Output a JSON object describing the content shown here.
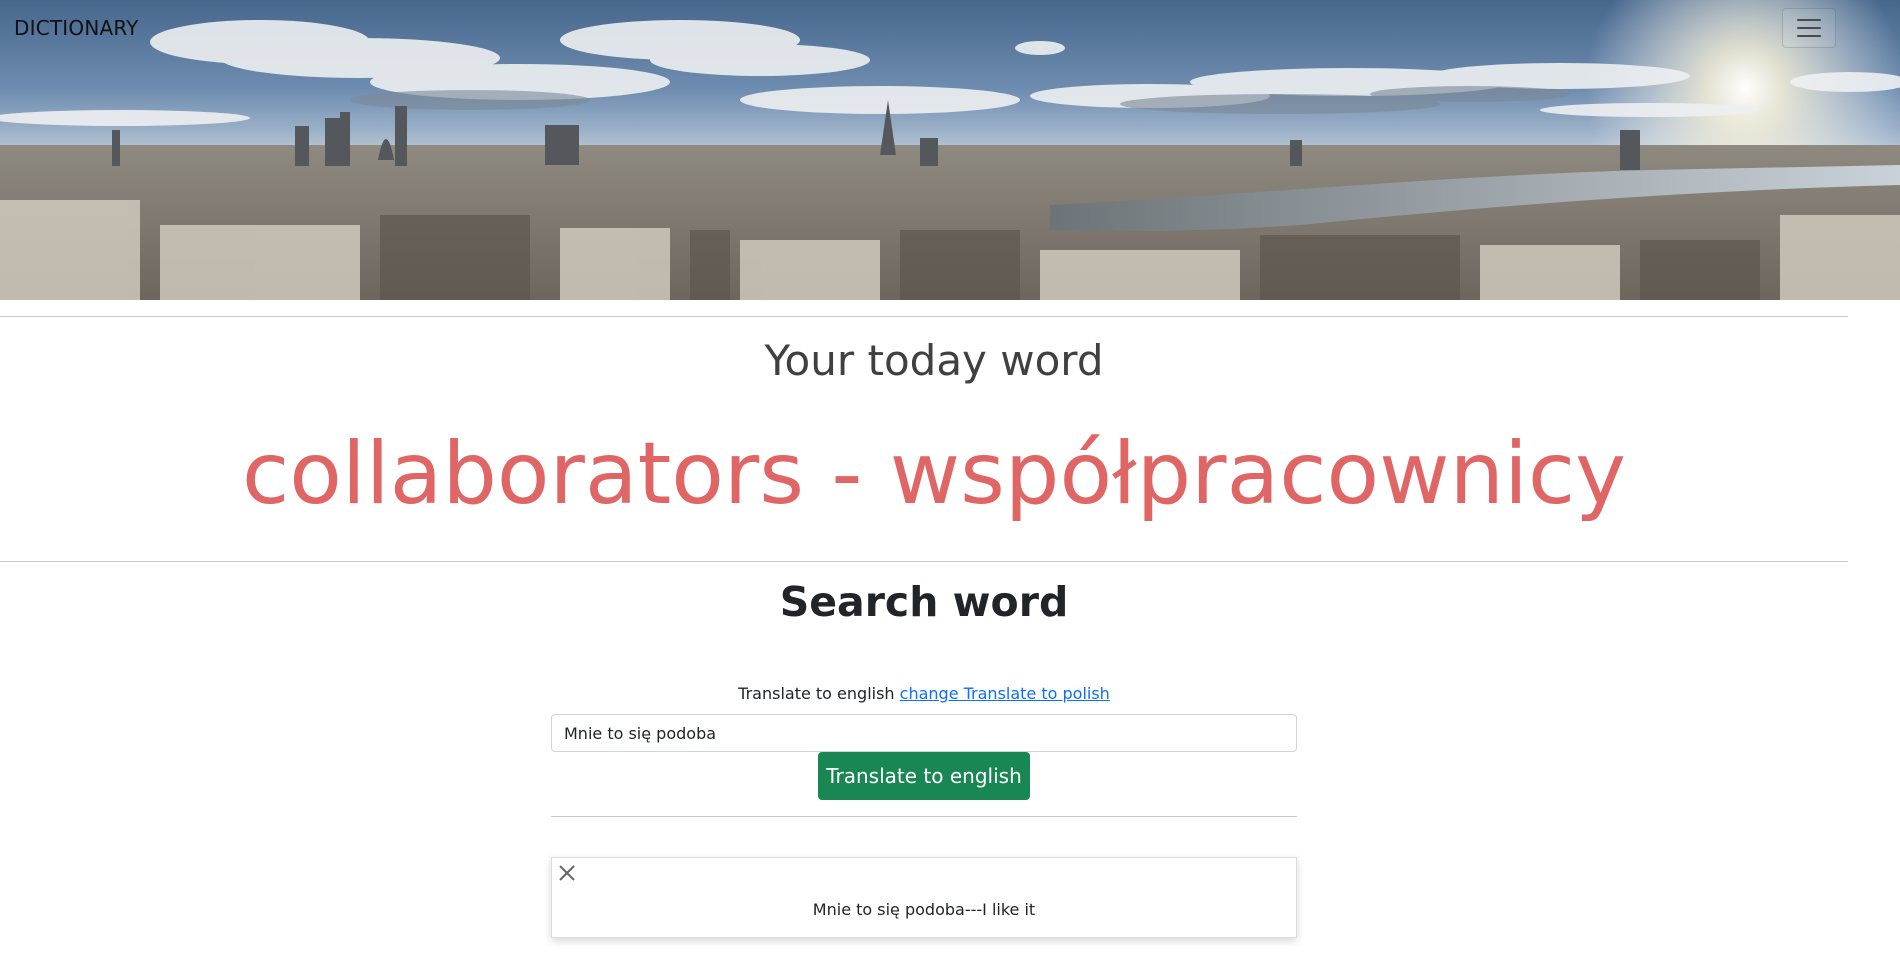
{
  "navbar": {
    "brand": "DICTIONARY",
    "menu_icon": "hamburger-menu-icon"
  },
  "hero": {
    "image_description_icon": "city-skyline-panorama"
  },
  "today": {
    "title": "Your today word",
    "word": "collaborators - współpracownicy",
    "word_color": "#e06666"
  },
  "search": {
    "title": "Search word",
    "direction_label": "Translate to english",
    "change_link": "change Translate to polish",
    "input_value": "Mnie to się podoba",
    "button_label": "Translate to english",
    "button_color": "#198754"
  },
  "result": {
    "close_icon": "close-icon",
    "text": "Mnie to się podoba---I like it"
  }
}
